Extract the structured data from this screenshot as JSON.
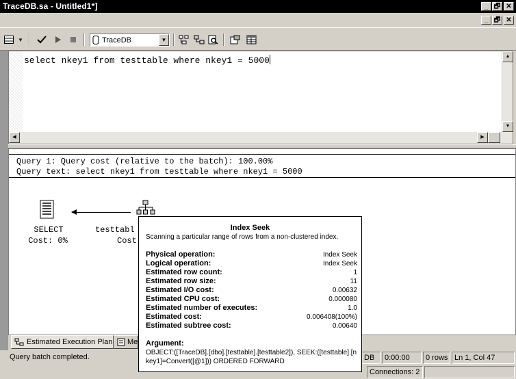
{
  "window": {
    "title": "TraceDB.sa - Untitled1*]",
    "controls": [
      "_",
      "🗗",
      "✕"
    ]
  },
  "toolbar": {
    "database": "TraceDB"
  },
  "editor": {
    "sql": "select nkey1 from testtable where nkey1 = 5000"
  },
  "plan": {
    "query_header": "Query 1: Query cost (relative to the batch): 100.00%",
    "query_text": "Query text: select nkey1 from testtable where nkey1 = 5000",
    "select_node": {
      "name": "SELECT",
      "cost": "Cost: 0%"
    },
    "seek_node": {
      "name": "testtabl",
      "cost": "Cost"
    }
  },
  "tooltip": {
    "title": "Index Seek",
    "description": "Scanning a particular range of rows from a non-clustered index.",
    "rows": [
      {
        "key": "Physical operation:",
        "value": "Index Seek"
      },
      {
        "key": "Logical operation:",
        "value": "Index Seek"
      },
      {
        "key": "Estimated row count:",
        "value": "1"
      },
      {
        "key": "Estimated row size:",
        "value": "11"
      },
      {
        "key": "Estimated I/O cost:",
        "value": "0.00632"
      },
      {
        "key": "Estimated CPU cost:",
        "value": "0.000080"
      },
      {
        "key": "Estimated number of executes:",
        "value": "1.0"
      },
      {
        "key": "Estimated cost:",
        "value": "0.006408(100%)"
      },
      {
        "key": "Estimated subtree cost:",
        "value": "0.00640"
      }
    ],
    "argument_label": "Argument:",
    "argument": "OBJECT:([TraceDB].[dbo].[testtable].[testtable2]), SEEK:([testtable].[nkey1]=Convert([@1])) ORDERED FORWARD"
  },
  "tabs": {
    "execution_plan": "Estimated Execution Plan",
    "messages": "Me"
  },
  "status": {
    "message": "Query batch completed.",
    "db": "DB",
    "time": "0:00:00",
    "rows": "0 rows",
    "position": "Ln 1, Col 47",
    "connections": "Connections: 2"
  }
}
